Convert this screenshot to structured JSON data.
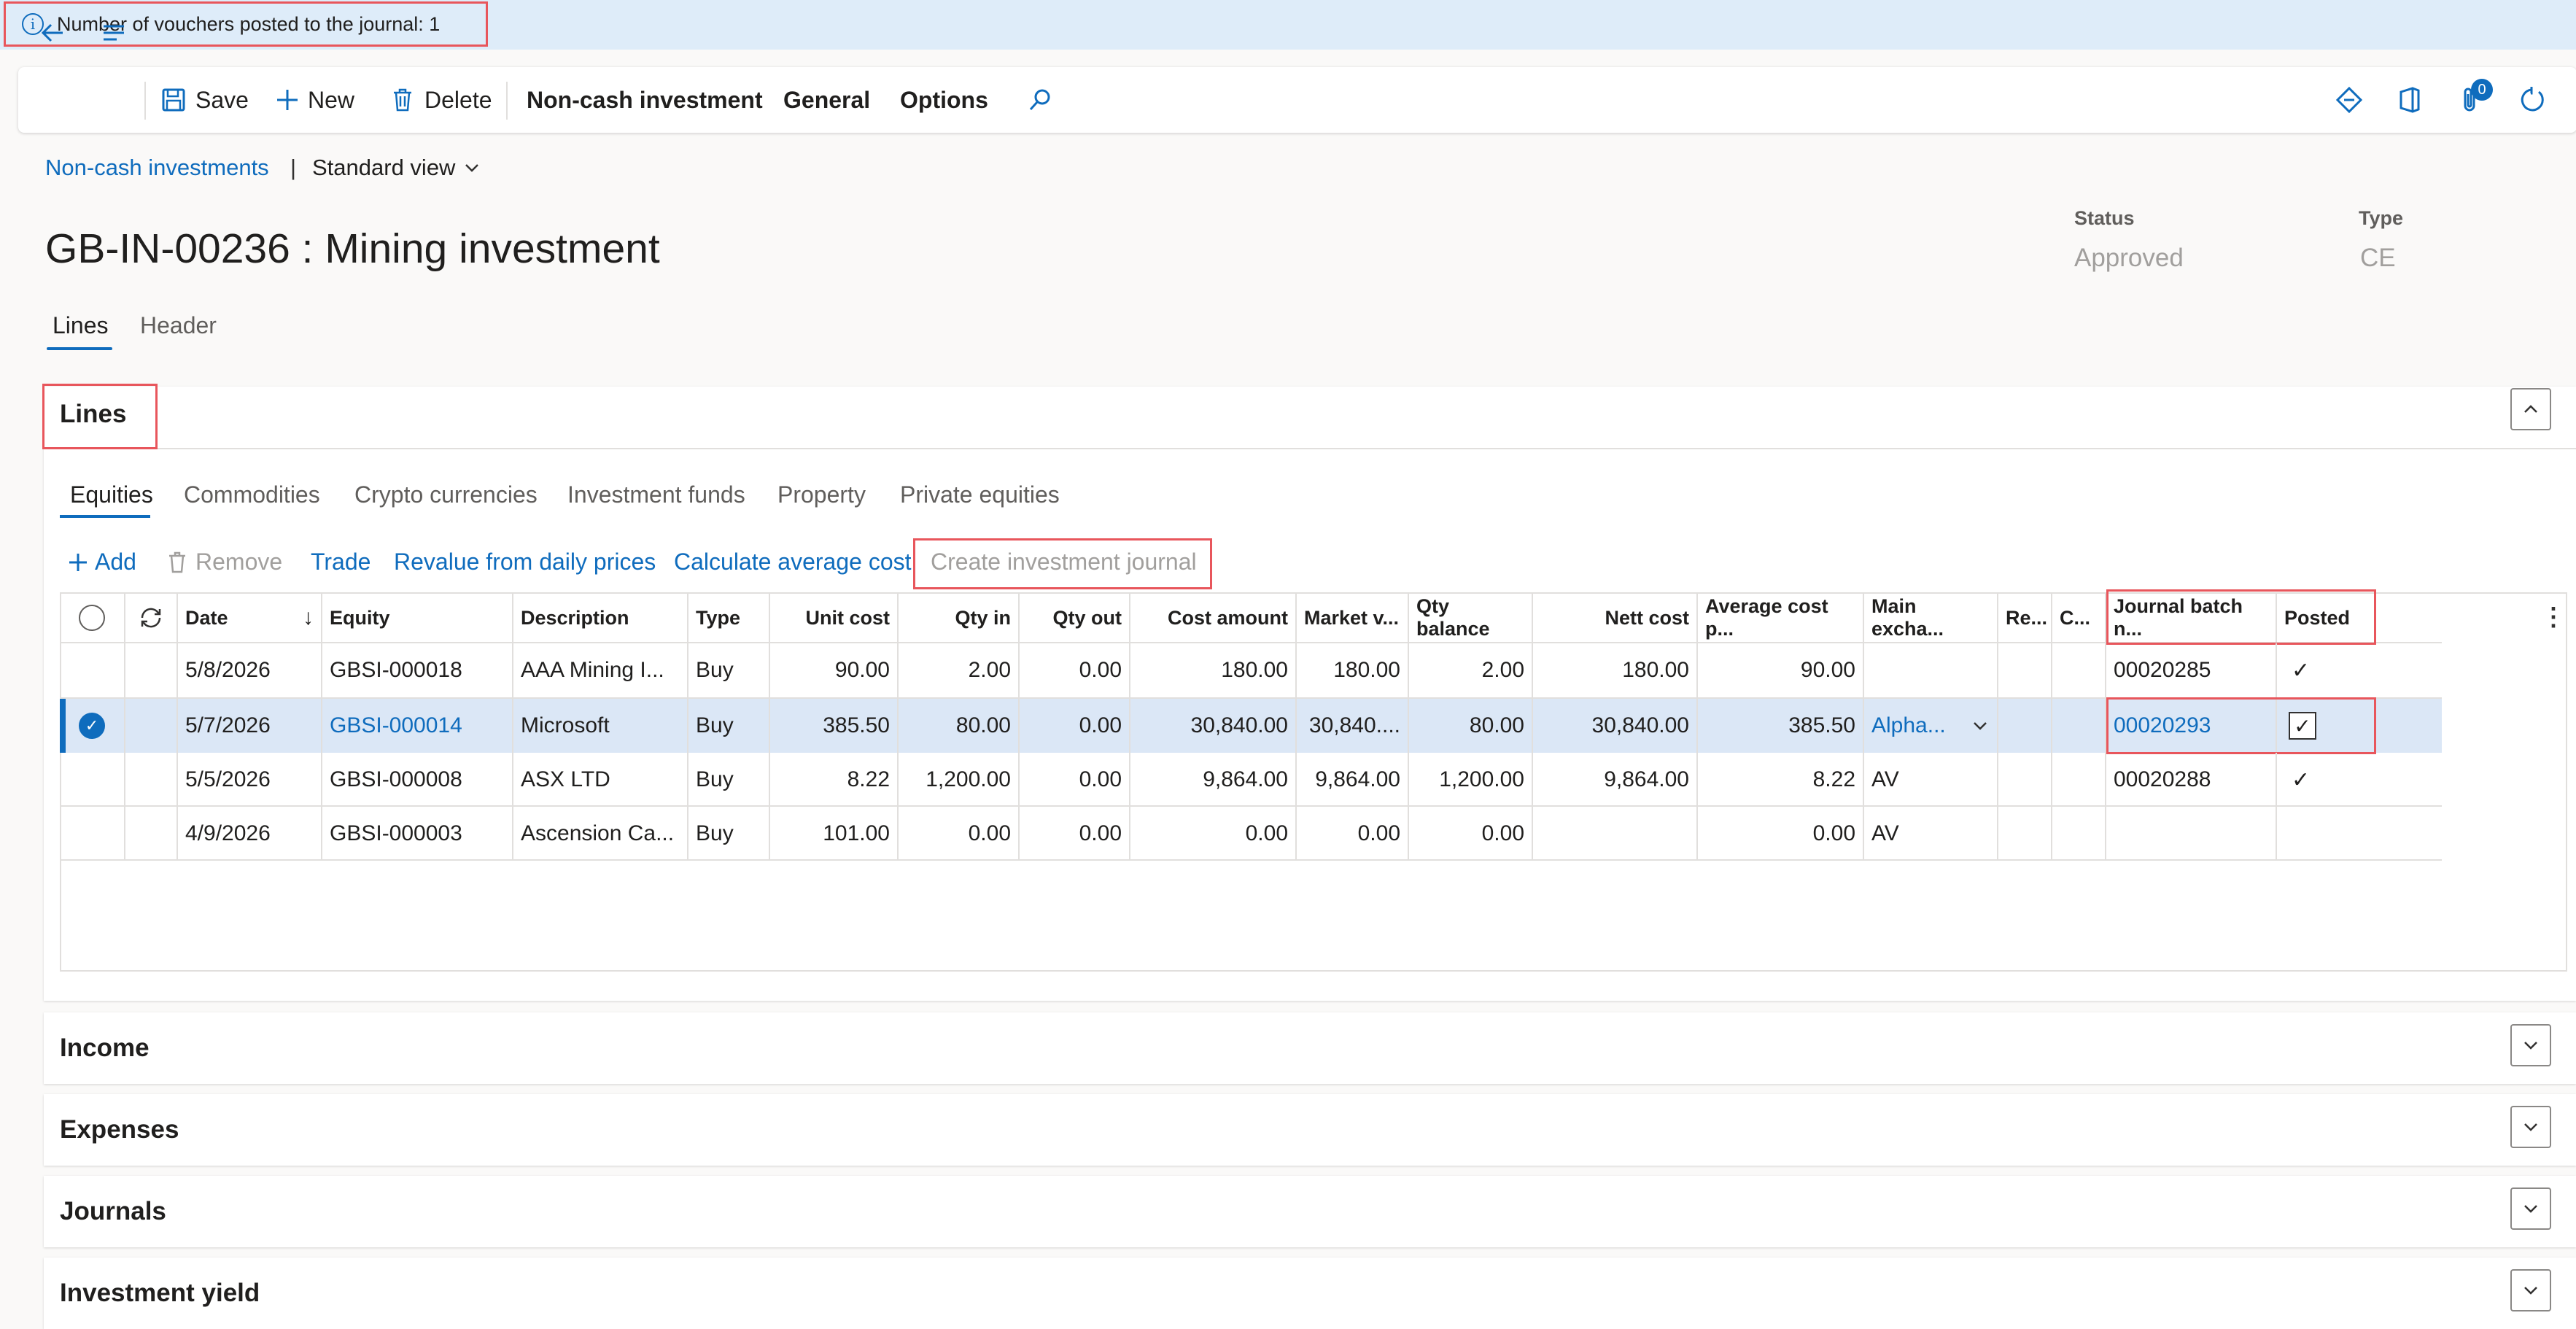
{
  "message_bar": {
    "icon": "info-icon",
    "text": "Number of vouchers posted to the journal: 1"
  },
  "action_pane": {
    "save": "Save",
    "new": "New",
    "delete": "Delete",
    "menus": [
      "Non-cash investment",
      "General",
      "Options"
    ],
    "attachments_count": "0"
  },
  "breadcrumb": {
    "link": "Non-cash investments",
    "separator": "|",
    "view": "Standard view"
  },
  "page_title": "GB-IN-00236 : Mining investment",
  "header_fields": {
    "status_label": "Status",
    "status_value": "Approved",
    "type_label": "Type",
    "type_value": "CE"
  },
  "page_tabs": [
    "Lines",
    "Header"
  ],
  "lines_section": {
    "title": "Lines",
    "sub_tabs": [
      "Equities",
      "Commodities",
      "Crypto currencies",
      "Investment funds",
      "Property",
      "Private equities"
    ],
    "toolbar": [
      "Add",
      "Remove",
      "Trade",
      "Revalue from daily prices",
      "Calculate average cost",
      "Create investment journal"
    ],
    "columns": [
      "Date",
      "Equity",
      "Description",
      "Type",
      "Unit cost",
      "Qty in",
      "Qty out",
      "Cost amount",
      "Market v...",
      "Qty balance",
      "Nett cost",
      "Average cost p...",
      "Main excha...",
      "Re...",
      "C...",
      "Journal batch n...",
      "Posted"
    ],
    "rows": [
      {
        "date": "5/8/2026",
        "equity": "GBSI-000018",
        "description": "AAA Mining I...",
        "type": "Buy",
        "unit_cost": "90.00",
        "qty_in": "2.00",
        "qty_out": "0.00",
        "cost_amount": "180.00",
        "market_value": "180.00",
        "qty_balance": "2.00",
        "nett_cost": "180.00",
        "avg_cost": "90.00",
        "main_exchange": "",
        "journal_batch": "00020285",
        "posted": true
      },
      {
        "date": "5/7/2026",
        "equity": "GBSI-000014",
        "description": "Microsoft",
        "type": "Buy",
        "unit_cost": "385.50",
        "qty_in": "80.00",
        "qty_out": "0.00",
        "cost_amount": "30,840.00",
        "market_value": "30,840....",
        "qty_balance": "80.00",
        "nett_cost": "30,840.00",
        "avg_cost": "385.50",
        "main_exchange": "Alpha...",
        "journal_batch": "00020293",
        "posted": true
      },
      {
        "date": "5/5/2026",
        "equity": "GBSI-000008",
        "description": "ASX LTD",
        "type": "Buy",
        "unit_cost": "8.22",
        "qty_in": "1,200.00",
        "qty_out": "0.00",
        "cost_amount": "9,864.00",
        "market_value": "9,864.00",
        "qty_balance": "1,200.00",
        "nett_cost": "9,864.00",
        "avg_cost": "8.22",
        "main_exchange": "AV",
        "journal_batch": "00020288",
        "posted": true
      },
      {
        "date": "4/9/2026",
        "equity": "GBSI-000003",
        "description": "Ascension Ca...",
        "type": "Buy",
        "unit_cost": "101.00",
        "qty_in": "0.00",
        "qty_out": "0.00",
        "cost_amount": "0.00",
        "market_value": "0.00",
        "qty_balance": "0.00",
        "nett_cost": "",
        "avg_cost": "0.00",
        "main_exchange": "AV",
        "journal_batch": "",
        "posted": false
      }
    ]
  },
  "collapsed_sections": [
    "Income",
    "Expenses",
    "Journals",
    "Investment yield"
  ],
  "colors": {
    "accent": "#0f6cbd",
    "highlight_border": "#e8565c",
    "message_bar_bg": "#deecf9",
    "selected_row_bg": "#dbe7f6"
  }
}
